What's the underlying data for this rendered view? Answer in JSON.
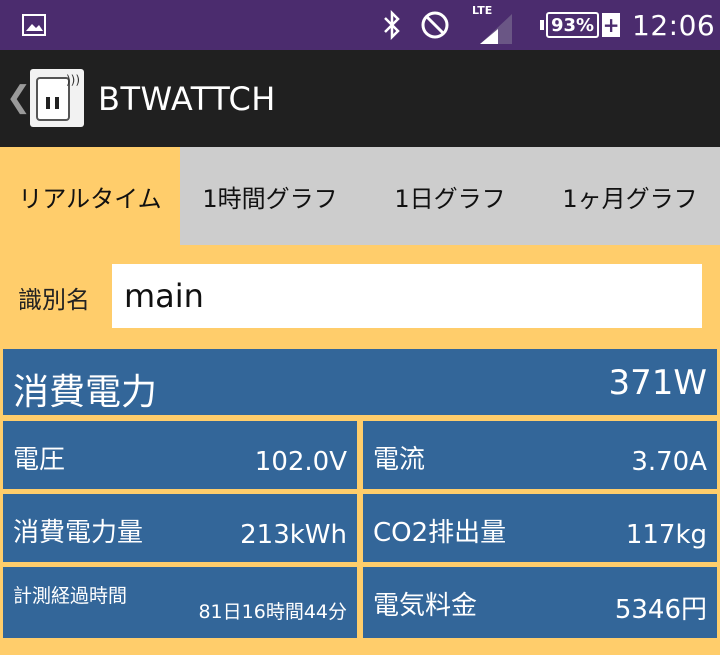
{
  "status_bar": {
    "lte": "LTE",
    "battery_percent": "93%",
    "battery_plus": "+",
    "time": "12:06"
  },
  "app_bar": {
    "title": "BTWATTCH"
  },
  "tabs": [
    {
      "label": "リアルタイム",
      "active": true
    },
    {
      "label": "1時間グラフ",
      "active": false
    },
    {
      "label": "1日グラフ",
      "active": false
    },
    {
      "label": "1ヶ月グラフ",
      "active": false
    }
  ],
  "name_field": {
    "label": "識別名",
    "value": "main"
  },
  "readings": {
    "power": {
      "label": "消費電力",
      "value": "371W"
    },
    "voltage": {
      "label": "電圧",
      "value": "102.0V"
    },
    "current": {
      "label": "電流",
      "value": "3.70A"
    },
    "energy": {
      "label": "消費電力量",
      "value": "213kWh"
    },
    "co2": {
      "label": "CO2排出量",
      "value": "117kg"
    },
    "elapsed": {
      "label": "計測経過時間",
      "value": "81日16時間44分"
    },
    "cost": {
      "label": "電気料金",
      "value": "5346円"
    }
  },
  "colors": {
    "status_bar": "#4b2c6e",
    "app_bar": "#202020",
    "background": "#ffcd6b",
    "cell": "#336699",
    "tab_inactive": "#cdcdcd"
  }
}
